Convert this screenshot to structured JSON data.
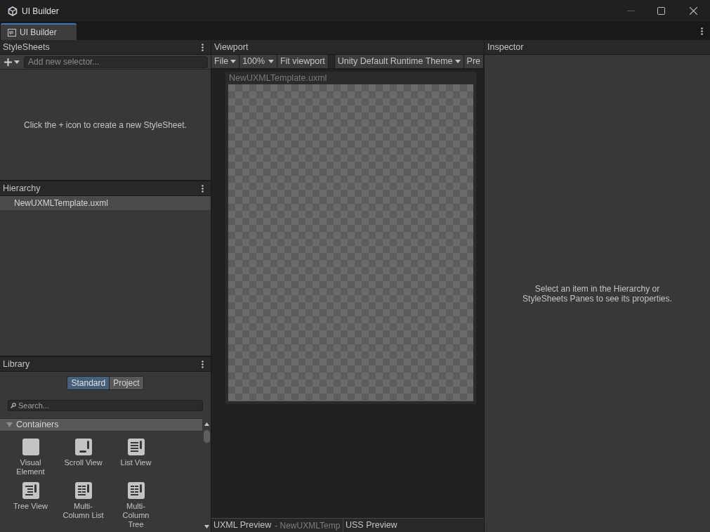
{
  "window": {
    "title": "UI Builder"
  },
  "tabs": [
    {
      "label": "UI Builder",
      "selected": true
    }
  ],
  "stylesheets": {
    "title": "StyleSheets",
    "selector_placeholder": "Add new selector...",
    "empty_message": "Click the + icon to create a new StyleSheet."
  },
  "hierarchy": {
    "title": "Hierarchy",
    "items": [
      {
        "label": "NewUXMLTemplate.uxml",
        "selected": true
      }
    ]
  },
  "library": {
    "title": "Library",
    "tabs": [
      {
        "label": "Standard",
        "selected": true
      },
      {
        "label": "Project",
        "selected": false
      }
    ],
    "search_placeholder": "Search...",
    "sections": [
      {
        "title": "Containers",
        "expanded": true,
        "items": [
          {
            "label": "Visual Element",
            "kind": "visual-element"
          },
          {
            "label": "Scroll View",
            "kind": "scroll-view"
          },
          {
            "label": "List View",
            "kind": "list-view"
          },
          {
            "label": "Tree View",
            "kind": "tree-view"
          },
          {
            "label": "Multi-Column List",
            "kind": "multi-column"
          },
          {
            "label": "Multi-Column Tree",
            "kind": "multi-column"
          }
        ]
      }
    ]
  },
  "viewport": {
    "title": "Viewport",
    "toolbar": [
      {
        "label": "File",
        "kind": "menu"
      },
      {
        "label": "100%",
        "kind": "dropdown"
      },
      {
        "label": "Fit viewport",
        "kind": "button"
      },
      {
        "label": "Unity Default Runtime Theme",
        "kind": "menu"
      },
      {
        "label": "Pre",
        "kind": "button"
      }
    ],
    "document_title": "NewUXMLTemplate.uxml"
  },
  "preview_tabs": [
    {
      "label": "UXML Preview",
      "suffix": "- NewUXMLTemp"
    },
    {
      "label": "USS Preview"
    }
  ],
  "inspector": {
    "title": "Inspector",
    "empty_message": "Select an item in the Hierarchy or StyleSheets Panes to see its properties."
  }
}
